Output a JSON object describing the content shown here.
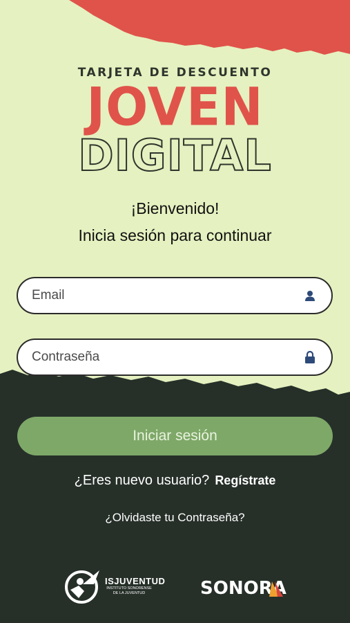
{
  "brand": {
    "line1": "TARJETA DE DESCUENTO",
    "line2": "JOVEN",
    "line3": "DIGITAL"
  },
  "welcome": "¡Bienvenido!",
  "subtitle": "Inicia sesión para continuar",
  "email_field": {
    "placeholder": "Email",
    "icon": "user-icon"
  },
  "password_field": {
    "placeholder": "Contraseña",
    "icon": "lock-icon"
  },
  "login_button": "Iniciar sesión",
  "register": {
    "prompt": "¿Eres nuevo usuario?",
    "link": "Regístrate"
  },
  "forgot_link": "¿Olvidaste tu Contraseña?",
  "footer": {
    "isj_name": "ISJUVENTUD",
    "isj_sub": "INSTITUTO SONORENSE DE LA JUVENTUD",
    "sonora": "SONORA"
  },
  "colors": {
    "background": "#e5f1c0",
    "accent_red": "#e0534a",
    "dark": "#2f352d",
    "button_green": "#7ea868"
  }
}
